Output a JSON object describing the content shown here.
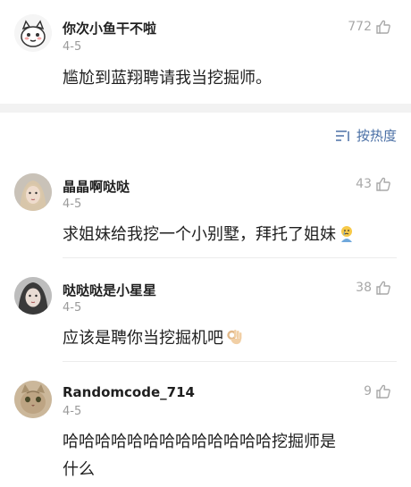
{
  "top_comment": {
    "username": "你次小鱼干不啦",
    "date": "4-5",
    "likes": "772",
    "text": "尴尬到蓝翔聘请我当挖掘师。"
  },
  "sort": {
    "label": "按热度",
    "icon": "sort-lines-icon"
  },
  "comments": [
    {
      "username": "晶晶啊哒哒",
      "date": "4-5",
      "likes": "43",
      "text": "求姐妹给我挖一个小别墅，拜托了姐妹",
      "emoji": "crying-face-emoji"
    },
    {
      "username": "哒哒哒是小星星",
      "date": "4-5",
      "likes": "38",
      "text": "应该是聘你当挖掘机吧",
      "emoji": "ok-hand-emoji"
    },
    {
      "username": "Randomcode_714",
      "date": "4-5",
      "likes": "9",
      "text": "哈哈哈哈哈哈哈哈哈哈哈哈哈挖掘师是什么"
    }
  ],
  "colors": {
    "accent": "#4a6fa5",
    "muted": "#9a9a9a",
    "separator": "#f2f2f2"
  }
}
